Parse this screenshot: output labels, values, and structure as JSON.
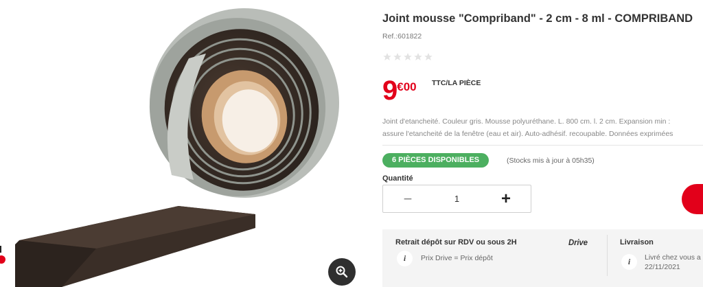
{
  "product": {
    "title": "Joint mousse \"Compriband\" - 2 cm - 8 ml - COMPRIBAND",
    "ref": "Ref.:601822",
    "rating": {
      "value": 0,
      "max": 5
    },
    "price": {
      "integer": "9",
      "currency": "€",
      "cents": "00",
      "unit": "TTC/LA PIÈCE"
    },
    "description_lines": [
      "Joint d'etancheité. Couleur gris. Mousse polyuréthane. L. 800 cm. l. 2 cm. Expansion min :",
      "assure l'etancheité de la fenêtre (eau et air). Auto-adhésif. recoupable. Données exprimées"
    ],
    "stock": {
      "badge": "6 PIÈCES DISPONIBLES",
      "note": "(Stocks mis à jour à 05h35)"
    },
    "quantity": {
      "label": "Quantité",
      "value": "1",
      "minus": "−",
      "plus": "+"
    }
  },
  "delivery": {
    "pickup": {
      "title": "Retrait dépôt sur RDV ou sous 2H",
      "logo": "Drive",
      "info": "Prix Drive = Prix dépôt"
    },
    "shipping": {
      "title": "Livraison",
      "line1": "Livré chez vous a",
      "line2": "22/11/2021"
    },
    "info_glyph": "i"
  },
  "colors": {
    "brand": "#e2001a",
    "stock": "#4caf60"
  },
  "icons": {
    "zoom": "zoom-in-icon",
    "star": "star-icon",
    "info": "info-icon"
  }
}
